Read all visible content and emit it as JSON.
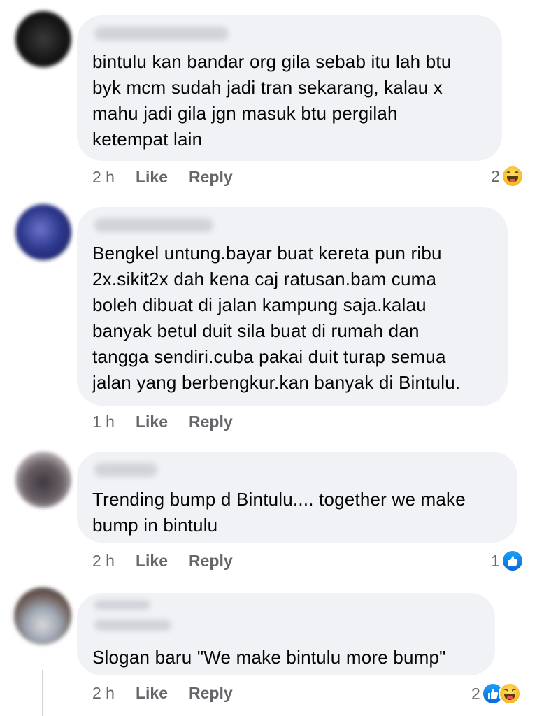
{
  "comments": [
    {
      "text": "bintulu kan bandar org gila sebab itu lah btu\nbyk mcm sudah jadi tran sekarang, kalau x\nmahu jadi gila jgn masuk btu pergilah\nketempat lain",
      "time": "2 h",
      "like_label": "Like",
      "reply_label": "Reply",
      "reaction_count": "2",
      "reactions": [
        "haha-icon"
      ]
    },
    {
      "text": "Bengkel untung.bayar buat kereta pun ribu\n2x.sikit2x dah kena caj ratusan.bam cuma\nboleh dibuat di jalan kampung saja.kalau\nbanyak betul duit sila buat di rumah dan\ntangga sendiri.cuba pakai duit turap semua\njalan yang berbengkur.kan banyak di Bintulu.",
      "time": "1 h",
      "like_label": "Like",
      "reply_label": "Reply",
      "reaction_count": "",
      "reactions": []
    },
    {
      "text": "Trending bump d Bintulu.... together we make\nbump in bintulu",
      "time": "2 h",
      "like_label": "Like",
      "reply_label": "Reply",
      "reaction_count": "1",
      "reactions": [
        "like-icon"
      ]
    },
    {
      "text": "Slogan baru \"We make bintulu more bump\"",
      "time": "2 h",
      "like_label": "Like",
      "reply_label": "Reply",
      "reaction_count": "2",
      "reactions": [
        "like-icon",
        "haha-icon"
      ]
    }
  ],
  "colors": {
    "bubble": "#f0f2f5",
    "meta_text": "#65676b",
    "like_blue": "#1877f2",
    "haha_yellow": "#f7b924"
  }
}
